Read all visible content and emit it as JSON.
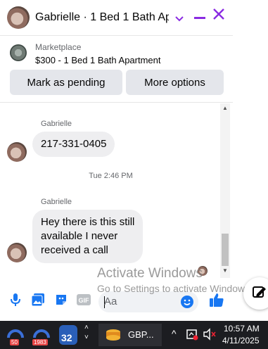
{
  "header": {
    "title": "Gabrielle · 1 Bed 1 Bath Ap...",
    "chevron_icon": "chevron-down-icon",
    "minimize_icon": "minus-icon",
    "close_icon": "close-icon",
    "accent_color": "#8a2be2"
  },
  "marketplace": {
    "label": "Marketplace",
    "listing": "$300 - 1 Bed 1 Bath Apartment",
    "buttons": {
      "pending": "Mark as pending",
      "more": "More options"
    }
  },
  "messages": [
    {
      "sender": "Gabrielle",
      "text": "217-331-0405"
    },
    {
      "timestamp": "Tue 2:46 PM"
    },
    {
      "sender": "Gabrielle",
      "lines": [
        "Hey there is this still",
        "available I never",
        "received a  call"
      ]
    }
  ],
  "composer": {
    "placeholder": "Aa",
    "icons": [
      "microphone-icon",
      "photo-icon",
      "sticker-icon",
      "gif-icon",
      "emoji-icon",
      "thumbs-up-icon"
    ],
    "gif_label": "GIF"
  },
  "watermark": {
    "line1": "Activate Windows",
    "line2": "Go to Settings to activate Windows."
  },
  "taskbar": {
    "badge_1": "50",
    "badge_2": "1983",
    "badge_3": "32",
    "app_label": "GBP...",
    "time": "10:57 AM",
    "date": "4/11/2025"
  }
}
